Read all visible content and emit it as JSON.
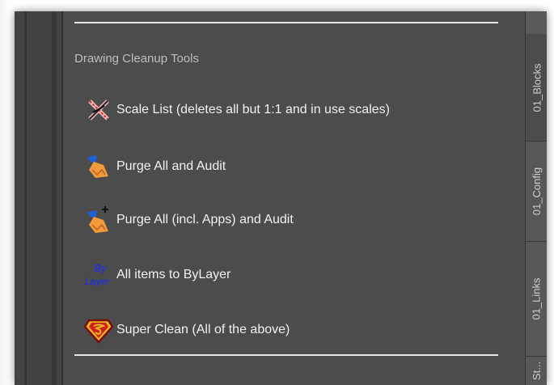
{
  "section": {
    "title": "Drawing Cleanup Tools"
  },
  "tools": [
    {
      "label": "Scale List (deletes all but 1:1 and in use scales)",
      "icon": "scale-list-delete-icon"
    },
    {
      "label": "Purge All and Audit",
      "icon": "purge-broom-icon"
    },
    {
      "label": "Purge All (incl. Apps) and Audit",
      "icon": "purge-broom-plus-icon"
    },
    {
      "label": "All items to ByLayer",
      "icon": "bylayer-icon",
      "icon_text_top": "By",
      "icon_text_bottom": "Layer"
    },
    {
      "label": "Super Clean (All of the above)",
      "icon": "superman-icon"
    }
  ],
  "tabs": [
    {
      "label": "01_Blocks"
    },
    {
      "label": "01_Config"
    },
    {
      "label": "01_Links"
    },
    {
      "label": "St..."
    }
  ],
  "colors": {
    "panel": "#4c4c4c",
    "text": "#f2f2f2",
    "title": "#bdbdbd",
    "bylayer_blue": "#1a2cff"
  }
}
